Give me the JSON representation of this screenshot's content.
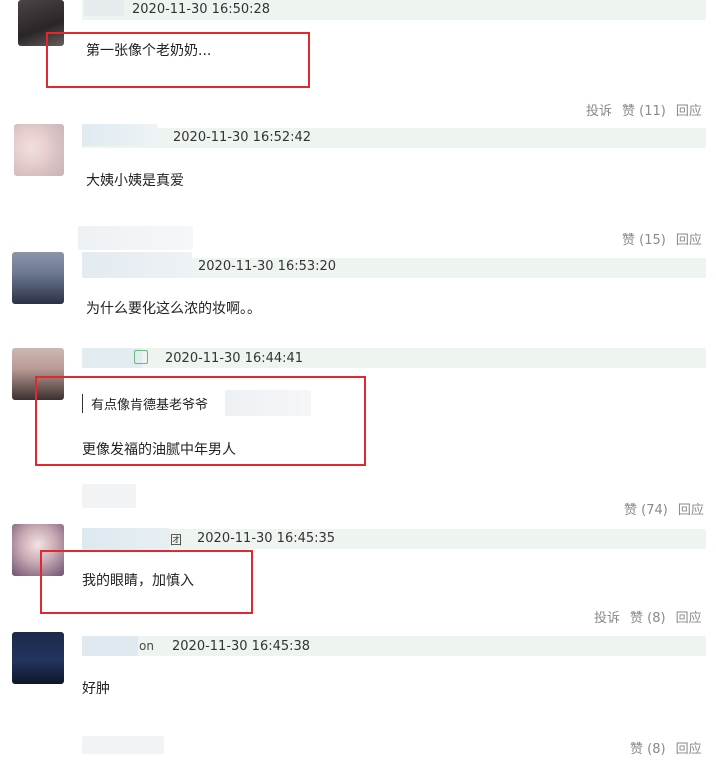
{
  "colors": {
    "accent_red": "#e0282e",
    "header_bg": "#eef5f1",
    "action_gray": "#8a8a8a"
  },
  "comments": [
    {
      "timestamp": "2020-11-30 16:50:28",
      "text": "第一张像个老奶奶...",
      "actions": {
        "report": "投诉",
        "like": "赞 (11)",
        "reply": "回应"
      }
    },
    {
      "timestamp": "2020-11-30 16:52:42",
      "text": "大姨小姨是真爱",
      "actions": {
        "like": "赞 (15)",
        "reply": "回应"
      }
    },
    {
      "timestamp": "2020-11-30 16:53:20",
      "text": "为什么要化这么浓的妆啊。。"
    },
    {
      "timestamp": "2020-11-30 16:44:41",
      "quote": "有点像肯德基老爷爷",
      "text": "更像发福的油腻中年男人",
      "actions": {
        "like": "赞 (74)",
        "reply": "回应"
      }
    },
    {
      "timestamp": "2020-11-30 16:45:35",
      "text": "我的眼睛，加慎入",
      "name_suffix": "团",
      "actions": {
        "report": "投诉",
        "like": "赞 (8)",
        "reply": "回应"
      }
    },
    {
      "timestamp": "2020-11-30 16:45:38",
      "text": "好肿",
      "name_suffix": "on",
      "actions": {
        "like": "赞 (8)",
        "reply": "回应"
      }
    }
  ]
}
